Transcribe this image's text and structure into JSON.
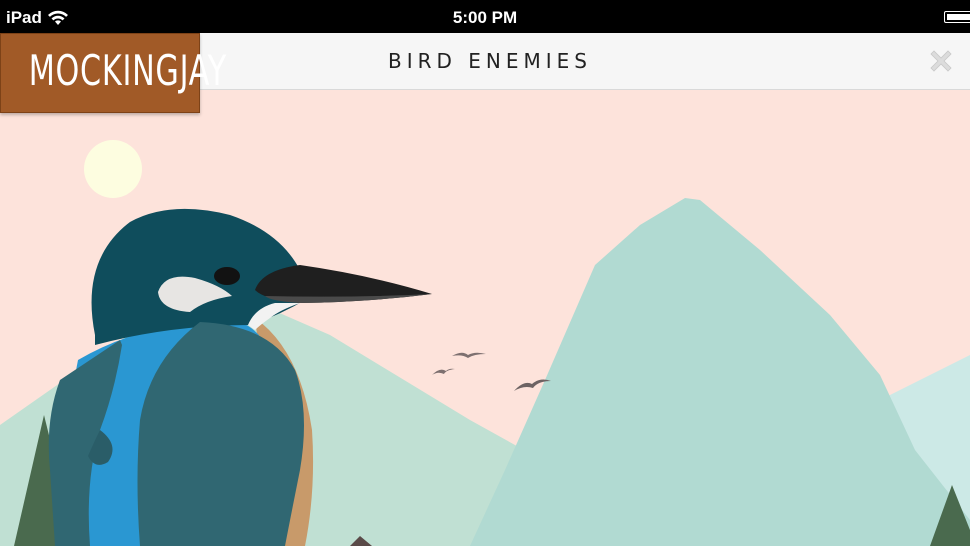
{
  "status_bar": {
    "device": "iPad",
    "time": "5:00 PM",
    "wifi_icon": "wifi-icon",
    "battery_icon": "battery-icon"
  },
  "brand": {
    "label": "MOCKINGJAY"
  },
  "navbar": {
    "title": "BIRD ENEMIES",
    "close_icon": "close-icon"
  },
  "scene": {
    "description_icon": "kingfisher-illustration",
    "colors": {
      "sky": "#fde3db",
      "sun": "#fdfde0",
      "mountain_main": "#b1dad2",
      "mountain_left": "#c0e0d3",
      "mountain_right": "#cce9e6",
      "tree": "#4a6a4e",
      "bird_head": "#0f4d5c",
      "bird_wing": "#306772",
      "bird_chest": "#2a97d2",
      "bird_back": "#c89a6a",
      "beak": "#222222",
      "brand_bg": "#a15a27"
    }
  }
}
